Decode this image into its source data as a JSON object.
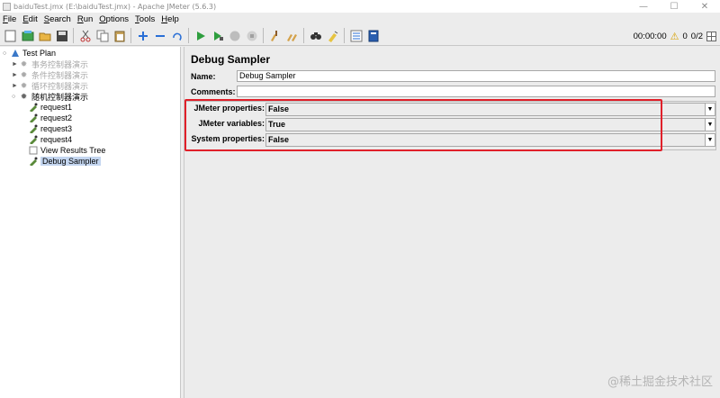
{
  "window": {
    "title": "baiduTest.jmx (E:\\baiduTest.jmx) - Apache JMeter (5.6.3)",
    "controls": [
      "—",
      "☐",
      "✕"
    ]
  },
  "menu": [
    {
      "ul": "F",
      "rest": "ile"
    },
    {
      "ul": "E",
      "rest": "dit"
    },
    {
      "ul": "S",
      "rest": "earch"
    },
    {
      "ul": "R",
      "rest": "un"
    },
    {
      "ul": "O",
      "rest": "ptions"
    },
    {
      "ul": "T",
      "rest": "ools"
    },
    {
      "ul": "H",
      "rest": "elp"
    }
  ],
  "toolbar": {
    "icons": [
      "new-icon",
      "templates-icon",
      "open-icon",
      "save-icon",
      "cut-icon",
      "copy-icon",
      "paste-icon",
      "expand-icon",
      "collapse-icon",
      "toggle-icon",
      "start-icon",
      "start-no-pause-icon",
      "stop-icon",
      "shutdown-icon",
      "clear-icon",
      "clear-all-icon",
      "search-icon",
      "reset-search-icon",
      "function-helper-icon",
      "help-icon"
    ],
    "elapsed": "00:00:00",
    "warnings": "0",
    "threads": "0/2"
  },
  "tree": {
    "root": "Test Plan",
    "items": [
      {
        "label": "事务控制器演示",
        "state": "disabled"
      },
      {
        "label": "条件控制器演示",
        "state": "disabled"
      },
      {
        "label": "循环控制器演示",
        "state": "disabled"
      },
      {
        "label": "随机控制器演示",
        "state": "enabled"
      },
      {
        "label": "request1"
      },
      {
        "label": "request2"
      },
      {
        "label": "request3"
      },
      {
        "label": "request4"
      },
      {
        "label": "View Results Tree"
      },
      {
        "label": "Debug Sampler",
        "state": "selected"
      }
    ]
  },
  "panel": {
    "title": "Debug Sampler",
    "name_label": "Name:",
    "name_value": "Debug Sampler",
    "comments_label": "Comments:",
    "comments_value": "",
    "props": [
      {
        "label": "JMeter properties:",
        "value": "False"
      },
      {
        "label": "JMeter variables:",
        "value": "True"
      },
      {
        "label": "System properties:",
        "value": "False"
      }
    ]
  },
  "watermark": "@稀土掘金技术社区",
  "colors": {
    "highlight": "#e0202a",
    "selection": "#c3d5ef",
    "accent": "#2a6fd6"
  }
}
